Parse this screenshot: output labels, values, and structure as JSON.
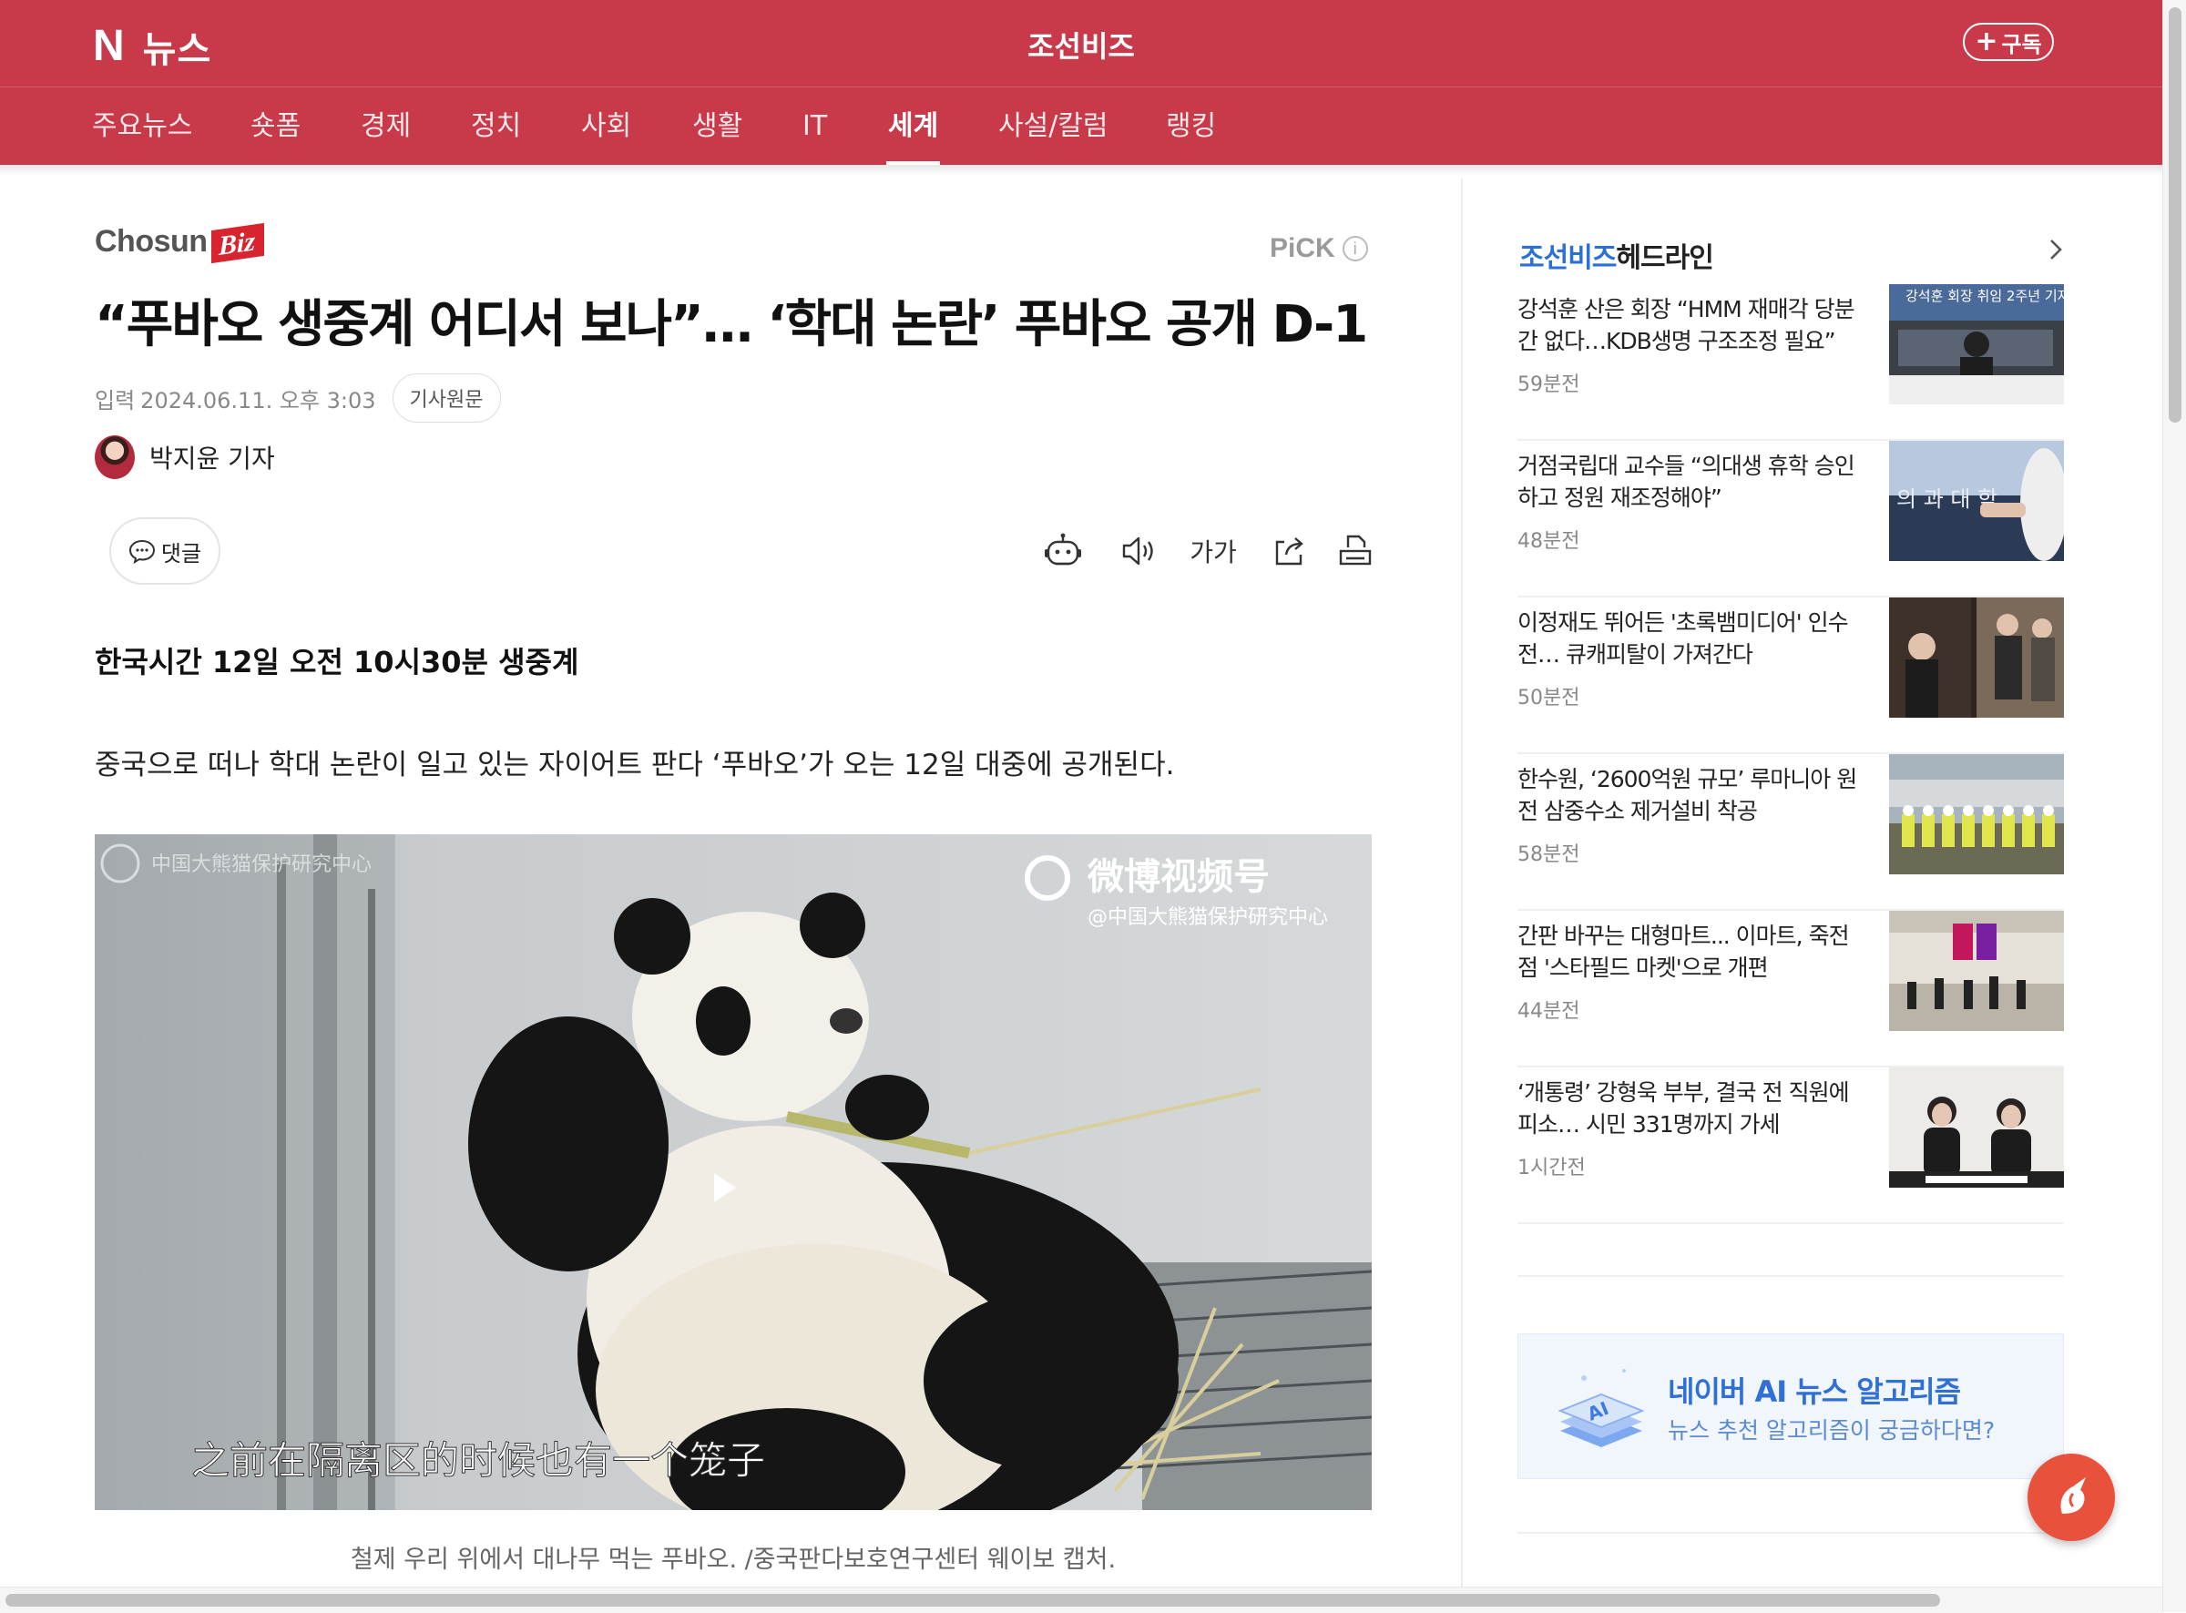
{
  "header": {
    "logo_letter": "N",
    "brand": "뉴스",
    "press_name": "조선비즈",
    "subscribe_label": "구독",
    "theme_color": "#c8394a"
  },
  "nav": {
    "items": [
      {
        "label": "주요뉴스"
      },
      {
        "label": "숏폼"
      },
      {
        "label": "경제"
      },
      {
        "label": "정치"
      },
      {
        "label": "사회"
      },
      {
        "label": "생활"
      },
      {
        "label": "IT"
      },
      {
        "label": "세계",
        "active": true
      },
      {
        "label": "사설/칼럼"
      },
      {
        "label": "랭킹"
      }
    ]
  },
  "article": {
    "press_logo_main": "Chosun",
    "press_logo_accent": "Biz",
    "pick_label": "PiCK",
    "title": "“푸바오 생중계 어디서 보나”… ‘학대 논란’ 푸바오 공개 D-1",
    "date_label": "입력",
    "date": "2024.06.11. 오후 3:03",
    "original_link_label": "기사원문",
    "reporter": "박지윤 기자",
    "comment_label": "댓글",
    "font_size_label": "가가",
    "subheading": "한국시간 12일 오전 10시30분 생중계",
    "lead": "중국으로 떠나 학대 논란이 일고 있는 자이어트 판다 ‘푸바오’가 오는 12일 대중에 공개된다.",
    "photo": {
      "watermark_main": "微博视频号",
      "watermark_sub": "@中国大熊猫保护研究中心",
      "corner_text": "中国大熊猫保护研究中心",
      "subtitle": "之前在隔离区的时候也有一个笼子"
    },
    "caption": "철제 우리 위에서 대나무 먹는 푸바오. /중국판다보호연구센터 웨이보 캡처."
  },
  "sidebar": {
    "title_press": "조선비즈",
    "title_rest": "헤드라인",
    "items": [
      {
        "title": "강석훈 산은 회장 “HMM 재매각 당분간 없다…KDB생명 구조조정 필요”",
        "ago": "59분전",
        "thumb_text": "강석훈 회장 취임 2주년 기자"
      },
      {
        "title": "거점국립대 교수들 “의대생 휴학 승인하고 정원 재조정해야”",
        "ago": "48분전",
        "thumb_text": "의 과 대 학"
      },
      {
        "title": "이정재도 뛰어든 '초록뱀미디어' 인수전… 큐캐피탈이 가져간다",
        "ago": "50분전",
        "thumb_text": ""
      },
      {
        "title": "한수원, ‘2600억원 규모’ 루마니아 원전 삼중수소 제거설비 착공",
        "ago": "58분전",
        "thumb_text": ""
      },
      {
        "title": "간판 바꾸는 대형마트... 이마트, 죽전점 '스타필드 마켓'으로 개편",
        "ago": "44분전",
        "thumb_text": ""
      },
      {
        "title": "‘개통령’ 강형욱 부부, 결국 전 직원에 피소… 시민 331명까지 가세",
        "ago": "1시간전",
        "thumb_text": ""
      }
    ],
    "ai_banner": {
      "title": "네이버 AI 뉴스 알고리즘",
      "subtitle": "뉴스 추천 알고리즘이 궁금하다면?",
      "icon_text": "AI"
    }
  }
}
